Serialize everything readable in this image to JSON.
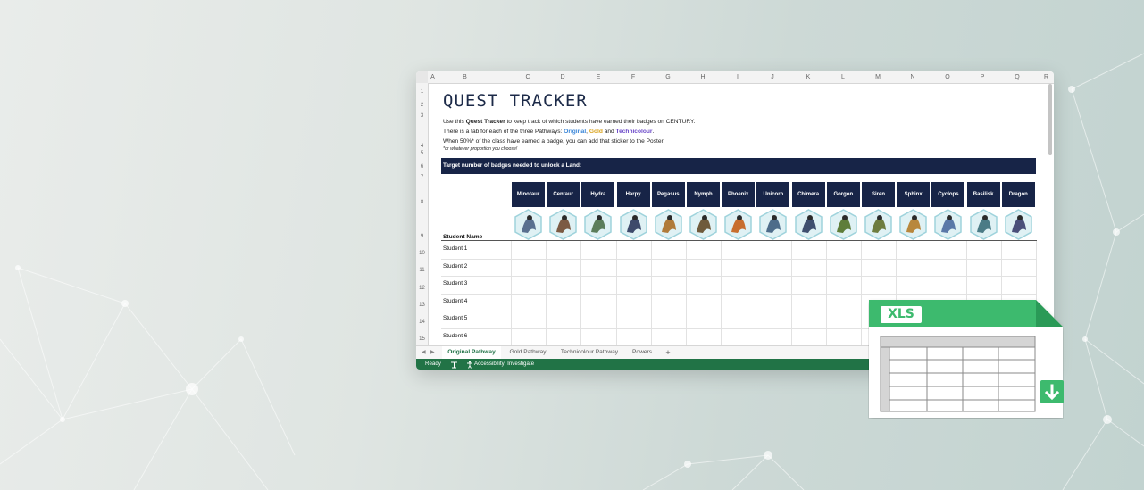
{
  "sheet": {
    "columns": [
      "A",
      "B",
      "C",
      "D",
      "E",
      "F",
      "G",
      "H",
      "I",
      "J",
      "K",
      "L",
      "M",
      "N",
      "O",
      "P",
      "Q",
      "R"
    ],
    "rows": [
      "1",
      "2",
      "3",
      "4",
      "5",
      "6",
      "7",
      "8",
      "9",
      "10",
      "11",
      "12",
      "13",
      "14",
      "15"
    ],
    "title": "QUEST TRACKER",
    "intro_line1_a": "Use this ",
    "intro_line1_b": "Quest Tracker",
    "intro_line1_c": " to keep track of which students have earned their badges on CENTURY.",
    "intro_line2_a": "There is a tab for each of the three Pathways: ",
    "intro_line2_orig": "Original",
    "intro_line2_sep1": ", ",
    "intro_line2_gold": "Gold",
    "intro_line2_and": " and ",
    "intro_line2_tech": "Technicolour",
    "intro_line2_end": ".",
    "intro_line3": "When 50%* of the class have earned a badge, you can add that sticker to the Poster.",
    "note": "*or whatever proportion you choose!",
    "target_label": "Target number of badges needed to unlock a Land:",
    "student_name_header": "Student Name",
    "creatures": [
      "Minotaur",
      "Centaur",
      "Hydra",
      "Harpy",
      "Pegasus",
      "Nymph",
      "Phoenix",
      "Unicorn",
      "Chimera",
      "Gorgon",
      "Siren",
      "Sphinx",
      "Cyclops",
      "Basilisk",
      "Dragon"
    ],
    "students": [
      "Student 1",
      "Student 2",
      "Student 3",
      "Student 4",
      "Student 5",
      "Student 6"
    ],
    "colors": {
      "header_navy": "#172447",
      "excel_green": "#217346",
      "accent_green": "#3dba6e"
    }
  },
  "tabs": {
    "prev_icon": "◀",
    "next_icon": "▶",
    "items": [
      "Original Pathway",
      "Gold Pathway",
      "Technicolour Pathway",
      "Powers"
    ],
    "add": "+"
  },
  "status": {
    "ready": "Ready",
    "accessibility": "Accessibility: Investigate"
  },
  "file_icon": {
    "badge": "XLS",
    "download_icon": "download-arrow-icon"
  }
}
